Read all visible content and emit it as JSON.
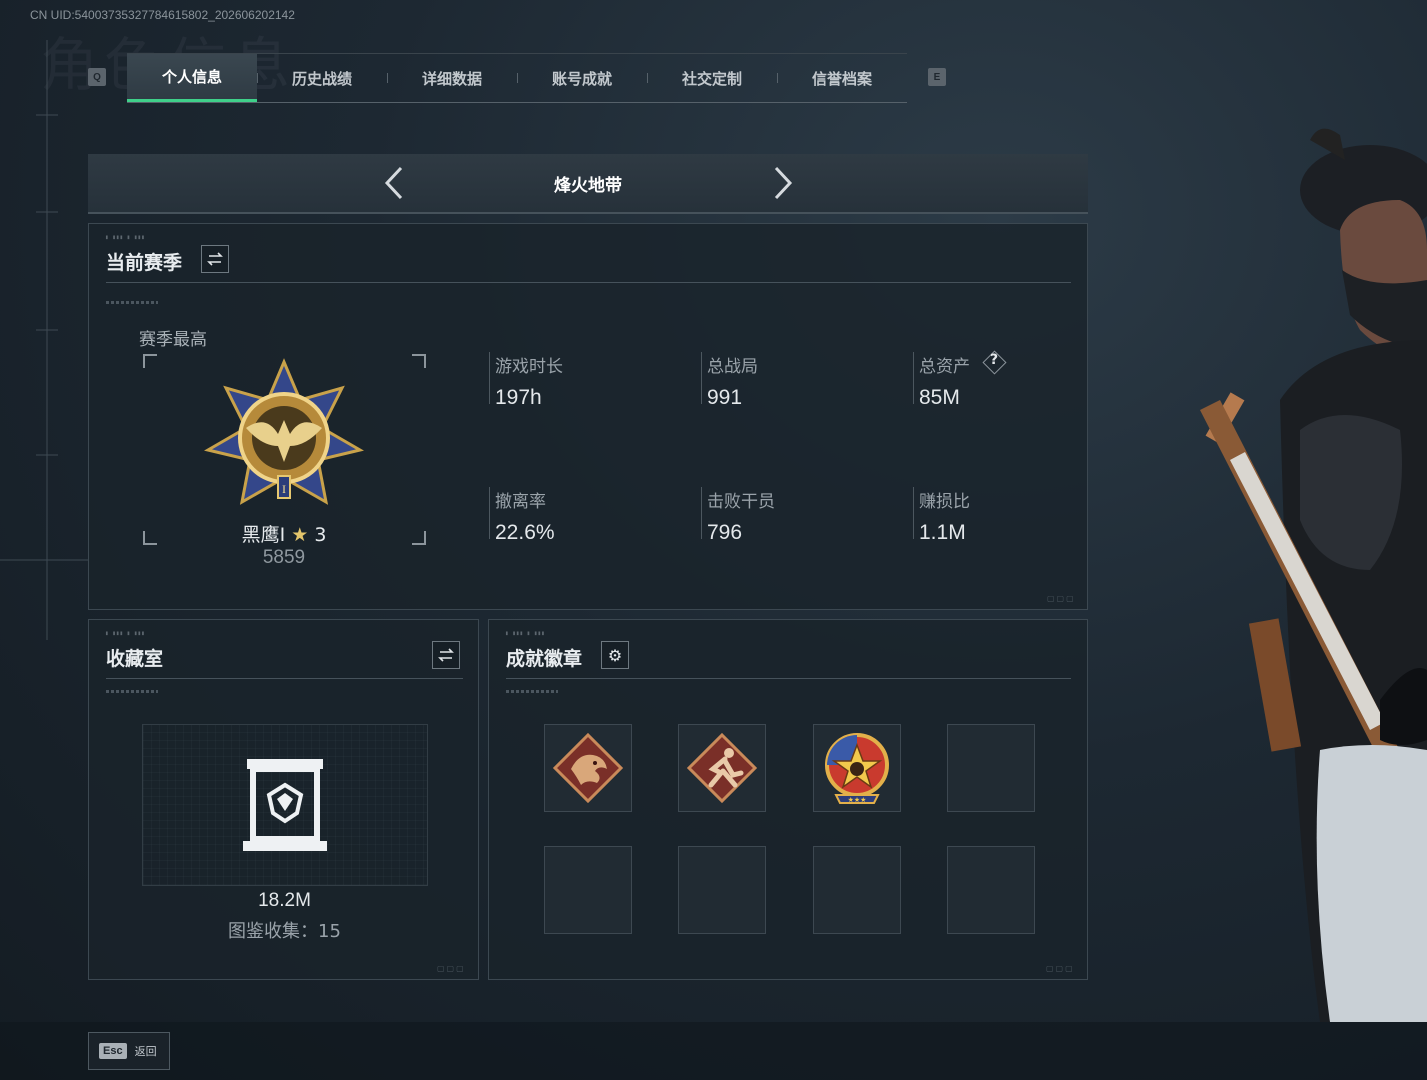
{
  "uid": "CN UID:5400373532778461580​2_202606202142",
  "bg_title": "角色信息",
  "tabs": {
    "left_key": "Q",
    "right_key": "E",
    "items": [
      {
        "label": "个人信息",
        "active": true
      },
      {
        "label": "历史战绩"
      },
      {
        "label": "详细数据"
      },
      {
        "label": "账号成就"
      },
      {
        "label": "社交定制"
      },
      {
        "label": "信誉档案"
      }
    ]
  },
  "mode": {
    "name": "烽火地带"
  },
  "season": {
    "title": "当前赛季",
    "best_label": "赛季最高",
    "rank_name": "黑鹰I",
    "rank_stars": "3",
    "rank_points": "5859",
    "stats": [
      {
        "label": "游戏时长",
        "value": "197h"
      },
      {
        "label": "总战局",
        "value": "991"
      },
      {
        "label": "总资产",
        "value": "85M",
        "help": "?"
      },
      {
        "label": "撤离率",
        "value": "22.6%"
      },
      {
        "label": "击败干员",
        "value": "796"
      },
      {
        "label": "赚损比",
        "value": "1.1M"
      }
    ]
  },
  "collection": {
    "title": "收藏室",
    "value": "18.2M",
    "codex_label": "图鉴收集：15"
  },
  "badges": {
    "title": "成就徽章",
    "slots": [
      "dragon-badge-icon",
      "runner-badge-icon",
      "star-skull-badge-icon",
      "",
      "",
      "",
      "",
      ""
    ]
  },
  "footer": {
    "esc_key": "Esc",
    "back_label": "返回"
  },
  "colors": {
    "accent": "#3fd08a",
    "panel": "#1a232b"
  }
}
